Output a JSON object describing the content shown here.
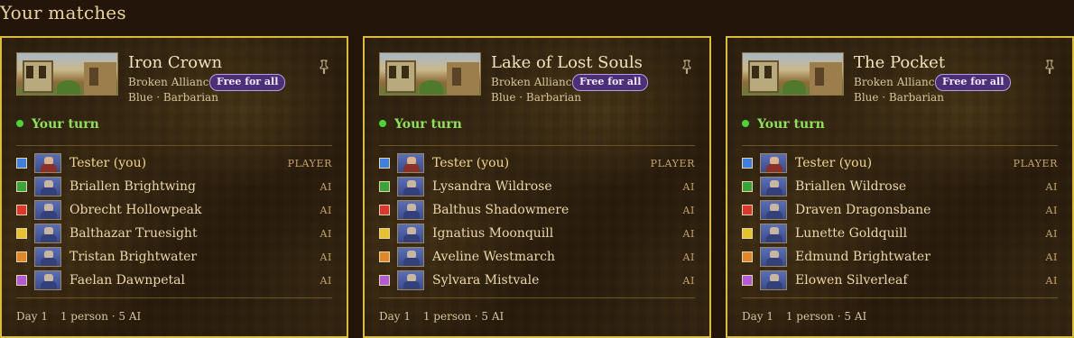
{
  "page": {
    "title": "Your matches"
  },
  "colors": {
    "card_border": "#d9bc3c",
    "turn_green": "#8ee05e",
    "badge_bg": "#4b2f77",
    "slot_colors": [
      "#3f7fe0",
      "#3aa33a",
      "#d9382f",
      "#e6c22e",
      "#e0862b",
      "#b35ad6"
    ]
  },
  "cards": [
    {
      "title": "Iron Crown",
      "scenario": "Broken Alliance",
      "mode": "Free for all",
      "faction": "Blue · Barbarian",
      "pin_icon": "pin-icon",
      "turn": "Your turn",
      "players": [
        {
          "name": "Tester (you)",
          "role": "PLAYER",
          "color": "#3f7fe0"
        },
        {
          "name": "Briallen Brightwing",
          "role": "AI",
          "color": "#3aa33a"
        },
        {
          "name": "Obrecht Hollowpeak",
          "role": "AI",
          "color": "#d9382f"
        },
        {
          "name": "Balthazar Truesight",
          "role": "AI",
          "color": "#e6c22e"
        },
        {
          "name": "Tristan Brightwater",
          "role": "AI",
          "color": "#e0862b"
        },
        {
          "name": "Faelan Dawnpetal",
          "role": "AI",
          "color": "#b35ad6"
        }
      ],
      "day": "Day 1",
      "summary": "1 person · 5 AI"
    },
    {
      "title": "Lake of Lost Souls",
      "scenario": "Broken Alliance",
      "mode": "Free for all",
      "faction": "Blue · Barbarian",
      "pin_icon": "pin-icon",
      "turn": "Your turn",
      "players": [
        {
          "name": "Tester (you)",
          "role": "PLAYER",
          "color": "#3f7fe0"
        },
        {
          "name": "Lysandra Wildrose",
          "role": "AI",
          "color": "#3aa33a"
        },
        {
          "name": "Balthus Shadowmere",
          "role": "AI",
          "color": "#d9382f"
        },
        {
          "name": "Ignatius Moonquill",
          "role": "AI",
          "color": "#e6c22e"
        },
        {
          "name": "Aveline Westmarch",
          "role": "AI",
          "color": "#e0862b"
        },
        {
          "name": "Sylvara Mistvale",
          "role": "AI",
          "color": "#b35ad6"
        }
      ],
      "day": "Day 1",
      "summary": "1 person · 5 AI"
    },
    {
      "title": "The Pocket",
      "scenario": "Broken Alliance",
      "mode": "Free for all",
      "faction": "Blue · Barbarian",
      "pin_icon": "pin-icon",
      "turn": "Your turn",
      "players": [
        {
          "name": "Tester (you)",
          "role": "PLAYER",
          "color": "#3f7fe0"
        },
        {
          "name": "Briallen Wildrose",
          "role": "AI",
          "color": "#3aa33a"
        },
        {
          "name": "Draven Dragonsbane",
          "role": "AI",
          "color": "#d9382f"
        },
        {
          "name": "Lunette Goldquill",
          "role": "AI",
          "color": "#e6c22e"
        },
        {
          "name": "Edmund Brightwater",
          "role": "AI",
          "color": "#e0862b"
        },
        {
          "name": "Elowen Silverleaf",
          "role": "AI",
          "color": "#b35ad6"
        }
      ],
      "day": "Day 1",
      "summary": "1 person · 5 AI"
    }
  ]
}
